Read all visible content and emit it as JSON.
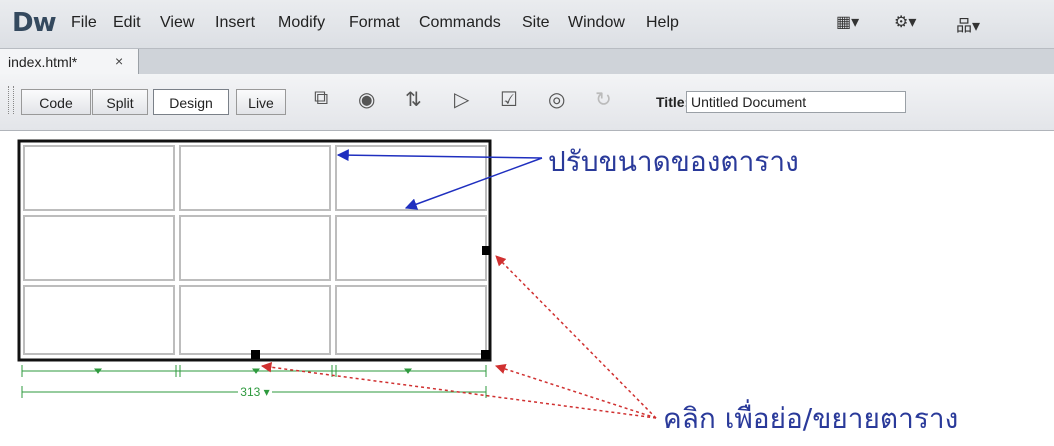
{
  "app": {
    "logo": "Dw"
  },
  "menu": {
    "items": [
      "File",
      "Edit",
      "View",
      "Insert",
      "Modify",
      "Format",
      "Commands",
      "Site",
      "Window",
      "Help"
    ]
  },
  "menu_icons": [
    {
      "name": "layout-icon",
      "glyph": "▦▾"
    },
    {
      "name": "gear-icon",
      "glyph": "⚙▾"
    },
    {
      "name": "site-icon",
      "glyph": "品▾"
    }
  ],
  "tab": {
    "label": "index.html*",
    "close": "×"
  },
  "toolbar": {
    "view_buttons": [
      "Code",
      "Split",
      "Design",
      "Live"
    ],
    "active_view": "Design",
    "title_label": "Title:",
    "title_value": "Untitled Document",
    "icons": [
      {
        "name": "multiscreen-icon",
        "glyph": "⧉"
      },
      {
        "name": "preview-browser-icon",
        "glyph": "◉"
      },
      {
        "name": "file-management-icon",
        "glyph": "⇅"
      },
      {
        "name": "visual-aids-icon",
        "glyph": "▷"
      },
      {
        "name": "validate-icon",
        "glyph": "☑"
      },
      {
        "name": "check-compat-icon",
        "glyph": "◎"
      },
      {
        "name": "refresh-icon",
        "glyph": "↻"
      }
    ]
  },
  "table": {
    "rows": 3,
    "cols": 3,
    "width_label": "313 ▾"
  },
  "annotations": {
    "resize_table": "ปรับขนาดของตาราง",
    "click_resize": "คลิก เพื่อย่อ/ขยายตาราง"
  },
  "colors": {
    "annotation_blue": "#2a3a9a",
    "arrow_blue": "#1f2fbf",
    "arrow_red": "#d03030",
    "width_green": "#2e9a3e"
  }
}
